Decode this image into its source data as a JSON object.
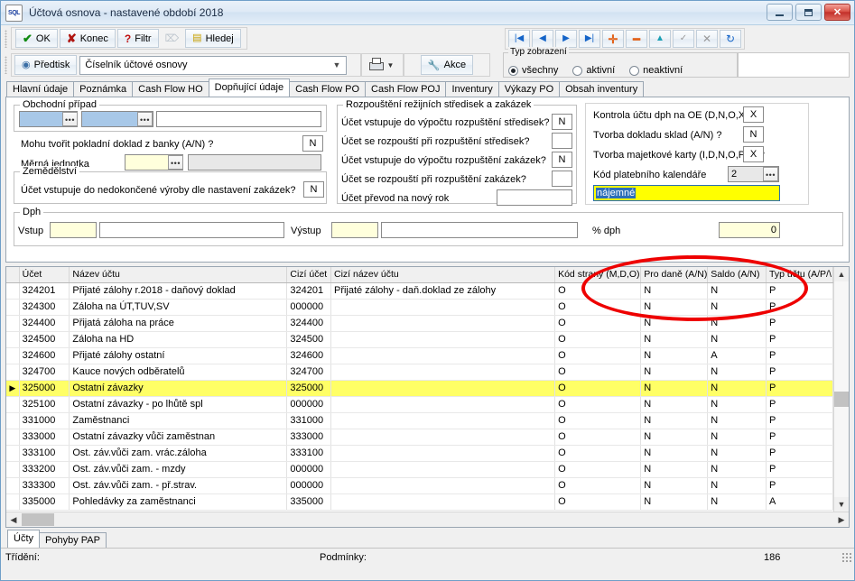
{
  "window": {
    "title": "Účtová osnova - nastavené období 2018",
    "app_icon_text": "SQL",
    "minimize_label": "",
    "maximize_label": "",
    "close_label": "✕"
  },
  "toolbar": {
    "ok": "OK",
    "konec": "Konec",
    "filtr": "Filtr",
    "hledej": "Hledej",
    "predtisk": "Předtisk",
    "combo_value": "Číselník účtové osnovy",
    "akce": "Akce"
  },
  "navbar": {
    "first": "|◀",
    "prev": "◀",
    "next": "▶",
    "last": "▶|",
    "add": "✛",
    "delete": "━",
    "edit": "▲",
    "post": "✓",
    "cancel": "✕",
    "refresh": "↻"
  },
  "view_type": {
    "legend": "Typ zobrazení",
    "options": [
      {
        "label": "všechny",
        "selected": true
      },
      {
        "label": "aktivní",
        "selected": false
      },
      {
        "label": "neaktivní",
        "selected": false
      }
    ]
  },
  "tabs": [
    {
      "label": "Hlavní údaje",
      "active": false
    },
    {
      "label": "Poznámka",
      "active": false
    },
    {
      "label": "Cash Flow HO",
      "active": false
    },
    {
      "label": "Dopňující údaje",
      "active": true
    },
    {
      "label": "Cash Flow PO",
      "active": false
    },
    {
      "label": "Cash Flow POJ",
      "active": false
    },
    {
      "label": "Inventury",
      "active": false
    },
    {
      "label": "Výkazy PO",
      "active": false
    },
    {
      "label": "Obsah inventury",
      "active": false
    }
  ],
  "form": {
    "obchodni_pripad": {
      "legend": "Obchodní případ",
      "field1": "",
      "field2": "",
      "field3": "",
      "ellipsis": "•••"
    },
    "pokladni_doklad": {
      "label": "Mohu tvořit pokladní doklad z banky (A/N) ?",
      "value": "N"
    },
    "merna_jednotka": {
      "label": "Měrná jednotka",
      "value": "",
      "desc": "",
      "ellipsis": "•••"
    },
    "zemedelstvi": {
      "legend": "Zemědělství",
      "label": "Účet vstupuje do nedokončené výroby dle nastavení zakázek?",
      "value": "N"
    },
    "dph": {
      "legend": "Dph",
      "vstup_label": "Vstup",
      "vstup_code": "",
      "vstup_text": "",
      "vystup_label": "Výstup",
      "vystup_code": "",
      "vystup_text": "",
      "pct_label": "% dph",
      "pct_value": "0"
    },
    "rozpousteni": {
      "legend": "Rozpouštění režijních středisek a zakázek",
      "rows": [
        {
          "label": "Účet vstupuje do výpočtu rozpuštění středisek?",
          "value": "N"
        },
        {
          "label": "Účet se rozpouští při rozpuštění středisek?",
          "value": ""
        },
        {
          "label": "Účet vstupuje do výpočtu rozpuštění zakázek?",
          "value": "N"
        },
        {
          "label": "Účet se rozpouští při rozpuštění zakázek?",
          "value": ""
        }
      ],
      "prevod_label": "Účet převod na nový rok",
      "prevod_value": ""
    },
    "right_col": {
      "rows": [
        {
          "label": "Kontrola účtu dph na OE (D,N,O,X) ?",
          "value": "X"
        },
        {
          "label": "Tvorba dokladu sklad  (A/N) ?",
          "value": "N"
        },
        {
          "label": "Tvorba majetkové karty (I,D,N,O,P,X) ?",
          "value": "X"
        }
      ],
      "kod_kalendare": {
        "label": "Kód platebního kalendáře",
        "value": "2",
        "ellipsis": "•••"
      },
      "kalendar_desc": "nájemné"
    }
  },
  "grid": {
    "columns": [
      "Účet",
      "Název účtu",
      "Cizí účet",
      "Cizí název účtu",
      "Kód strany (M,D,O)",
      "Pro daně (A/N)",
      "Saldo (A/N)",
      "Typ účtu (A/P/\\"
    ],
    "rows": [
      {
        "marker": "",
        "ucet": "324201",
        "nazev": "Přijaté zálohy r.2018 - daňový doklad",
        "cizi_ucet": "324201",
        "cizi_nazev": "Přijaté zálohy - daň.doklad ze zálohy",
        "kod_strany": "O",
        "pro_dane": "N",
        "saldo": "N",
        "typ": "P",
        "selected": false
      },
      {
        "marker": "",
        "ucet": "324300",
        "nazev": "Záloha na ÚT,TUV,SV",
        "cizi_ucet": "000000",
        "cizi_nazev": "",
        "kod_strany": "O",
        "pro_dane": "N",
        "saldo": "N",
        "typ": "P",
        "selected": false
      },
      {
        "marker": "",
        "ucet": "324400",
        "nazev": "Přijatá záloha na práce",
        "cizi_ucet": "324400",
        "cizi_nazev": "",
        "kod_strany": "O",
        "pro_dane": "N",
        "saldo": "N",
        "typ": "P",
        "selected": false
      },
      {
        "marker": "",
        "ucet": "324500",
        "nazev": "Záloha na HD",
        "cizi_ucet": "324500",
        "cizi_nazev": "",
        "kod_strany": "O",
        "pro_dane": "N",
        "saldo": "N",
        "typ": "P",
        "selected": false
      },
      {
        "marker": "",
        "ucet": "324600",
        "nazev": "Přijaté zálohy ostatní",
        "cizi_ucet": "324600",
        "cizi_nazev": "",
        "kod_strany": "O",
        "pro_dane": "N",
        "saldo": "A",
        "typ": "P",
        "selected": false
      },
      {
        "marker": "",
        "ucet": "324700",
        "nazev": "Kauce nových odběratelů",
        "cizi_ucet": "324700",
        "cizi_nazev": "",
        "kod_strany": "O",
        "pro_dane": "N",
        "saldo": "N",
        "typ": "P",
        "selected": false
      },
      {
        "marker": "▶",
        "ucet": "325000",
        "nazev": "Ostatní závazky",
        "cizi_ucet": "325000",
        "cizi_nazev": "",
        "kod_strany": "O",
        "pro_dane": "N",
        "saldo": "N",
        "typ": "P",
        "selected": true
      },
      {
        "marker": "",
        "ucet": "325100",
        "nazev": "Ostatní závazky - po lhůtě spl",
        "cizi_ucet": "000000",
        "cizi_nazev": "",
        "kod_strany": "O",
        "pro_dane": "N",
        "saldo": "N",
        "typ": "P",
        "selected": false
      },
      {
        "marker": "",
        "ucet": "331000",
        "nazev": "Zaměstnanci",
        "cizi_ucet": "331000",
        "cizi_nazev": "",
        "kod_strany": "O",
        "pro_dane": "N",
        "saldo": "N",
        "typ": "P",
        "selected": false
      },
      {
        "marker": "",
        "ucet": "333000",
        "nazev": "Ostatní závazky vůči zaměstnan",
        "cizi_ucet": "333000",
        "cizi_nazev": "",
        "kod_strany": "O",
        "pro_dane": "N",
        "saldo": "N",
        "typ": "P",
        "selected": false
      },
      {
        "marker": "",
        "ucet": "333100",
        "nazev": "Ost. záv.vůči zam. vrác.záloha",
        "cizi_ucet": "333100",
        "cizi_nazev": "",
        "kod_strany": "O",
        "pro_dane": "N",
        "saldo": "N",
        "typ": "P",
        "selected": false
      },
      {
        "marker": "",
        "ucet": "333200",
        "nazev": "Ost. záv.vůči zam. - mzdy",
        "cizi_ucet": "000000",
        "cizi_nazev": "",
        "kod_strany": "O",
        "pro_dane": "N",
        "saldo": "N",
        "typ": "P",
        "selected": false
      },
      {
        "marker": "",
        "ucet": "333300",
        "nazev": "Ost. záv.vůči zam. - př.strav.",
        "cizi_ucet": "000000",
        "cizi_nazev": "",
        "kod_strany": "O",
        "pro_dane": "N",
        "saldo": "N",
        "typ": "P",
        "selected": false
      },
      {
        "marker": "",
        "ucet": "335000",
        "nazev": "Pohledávky za zaměstnanci",
        "cizi_ucet": "335000",
        "cizi_nazev": "",
        "kod_strany": "O",
        "pro_dane": "N",
        "saldo": "N",
        "typ": "A",
        "selected": false
      }
    ]
  },
  "bottom_tabs": [
    {
      "label": "Účty",
      "active": true
    },
    {
      "label": "Pohyby PAP",
      "active": false
    }
  ],
  "statusbar": {
    "trideni": "Třídění:",
    "podminky": "Podmínky:",
    "count": "186"
  }
}
